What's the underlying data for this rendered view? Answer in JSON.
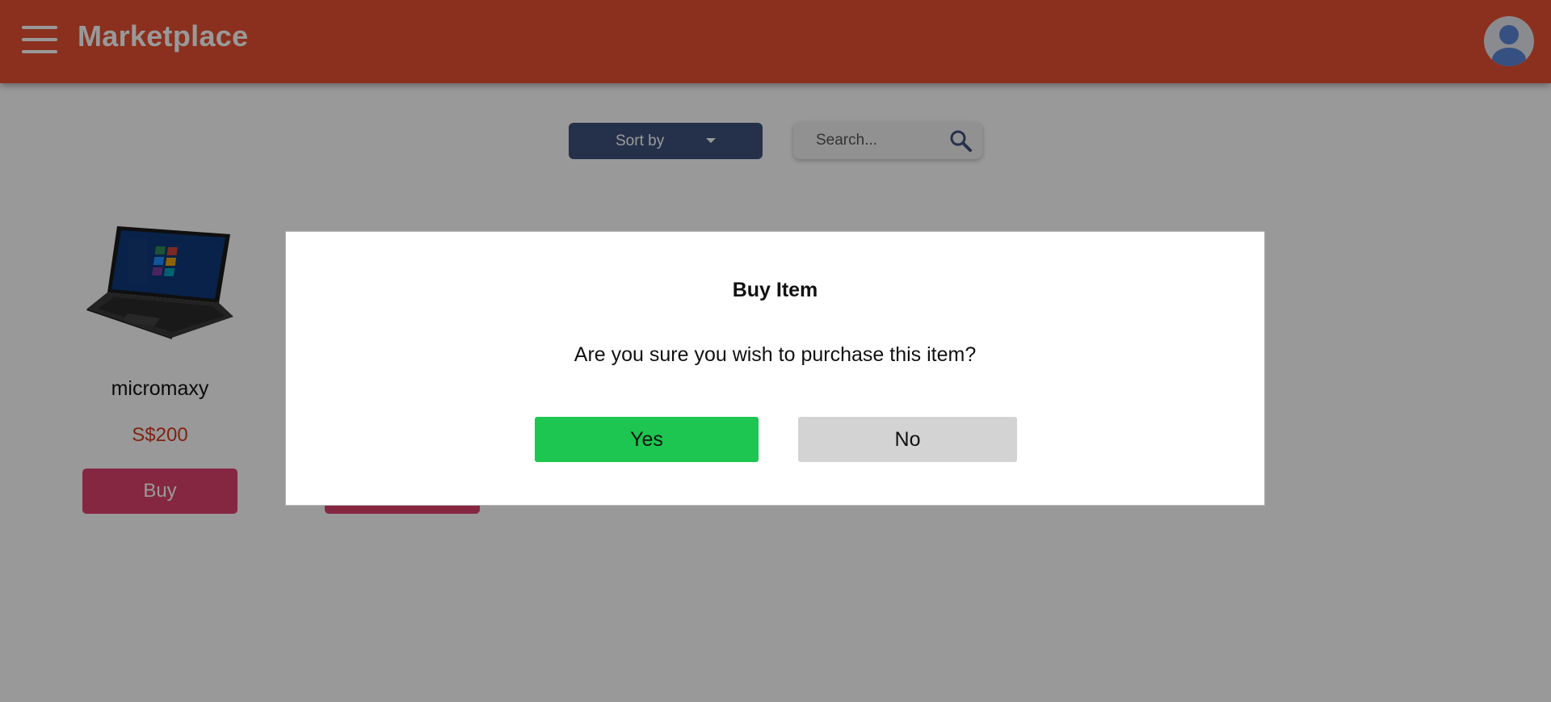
{
  "header": {
    "app_title": "Marketplace",
    "menu_icon": "hamburger-menu-icon",
    "avatar_icon": "user-avatar-icon",
    "background_color": "#e85133"
  },
  "toolbar": {
    "sort_label": "Sort by",
    "sort_icon": "caret-down-icon",
    "search": {
      "placeholder": "Search...",
      "value": "",
      "icon": "magnifier-icon"
    }
  },
  "products": [
    {
      "name": "micromaxy",
      "price": "S$200",
      "buy_label": "Buy",
      "image_icon": "laptop-image"
    },
    {
      "name": "",
      "price": "",
      "buy_label": "",
      "image_icon": ""
    }
  ],
  "modal": {
    "title": "Buy Item",
    "message": "Are you sure you wish to purchase this item?",
    "yes_label": "Yes",
    "no_label": "No",
    "yes_color": "#1cc650",
    "no_color": "#d3d3d3"
  }
}
